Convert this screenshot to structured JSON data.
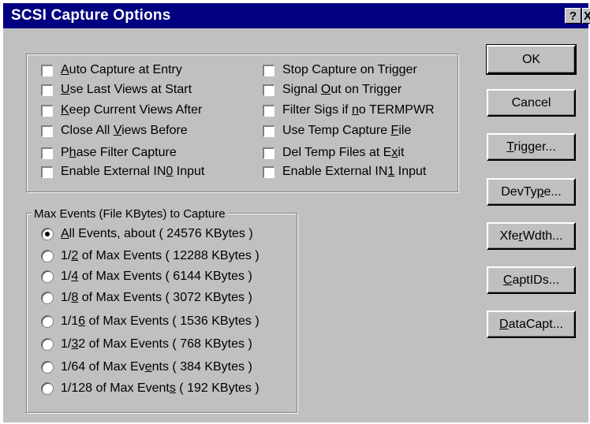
{
  "window": {
    "title": "SCSI Capture Options",
    "help_label": "?",
    "close_label": "X"
  },
  "options": {
    "left": [
      {
        "pre": "",
        "key": "A",
        "post": "uto Capture at Entry"
      },
      {
        "pre": "",
        "key": "U",
        "post": "se Last Views at Start"
      },
      {
        "pre": "",
        "key": "K",
        "post": "eep Current Views After"
      },
      {
        "pre": "Close All ",
        "key": "V",
        "post": "iews Before"
      },
      {
        "pre": "P",
        "key": "h",
        "post": "ase Filter Capture"
      },
      {
        "pre": "Enable External IN",
        "key": "0",
        "post": " Input"
      }
    ],
    "right": [
      {
        "pre": "Stop Capture on Trigger",
        "key": "",
        "post": ""
      },
      {
        "pre": "Signal ",
        "key": "O",
        "post": "ut on Trigger"
      },
      {
        "pre": "Filter Sigs if ",
        "key": "n",
        "post": "o TERMPWR"
      },
      {
        "pre": "Use Temp Capture ",
        "key": "F",
        "post": "ile"
      },
      {
        "pre": "Del Temp Files at E",
        "key": "x",
        "post": "it"
      },
      {
        "pre": "Enable External IN",
        "key": "1",
        "post": " Input"
      }
    ]
  },
  "max_events": {
    "legend": "Max Events (File KBytes) to Capture",
    "selected_index": 0,
    "options": [
      {
        "pre": "",
        "key": "A",
        "post": "ll Events, about ( 24576 KBytes )"
      },
      {
        "pre": "1/",
        "key": "2",
        "post": " of Max Events ( 12288 KBytes )"
      },
      {
        "pre": "1/",
        "key": "4",
        "post": " of Max Events ( 6144 KBytes )"
      },
      {
        "pre": "1/",
        "key": "8",
        "post": " of Max Events ( 3072 KBytes )"
      },
      {
        "pre": "1/1",
        "key": "6",
        "post": " of Max Events ( 1536 KBytes )"
      },
      {
        "pre": "1/",
        "key": "3",
        "post": "2 of Max Events ( 768 KBytes )"
      },
      {
        "pre": "1/64 of Max Ev",
        "key": "e",
        "post": "nts ( 384 KBytes )"
      },
      {
        "pre": "1/128 of Max Event",
        "key": "s",
        "post": " ( 192 KBytes )"
      }
    ]
  },
  "buttons": [
    {
      "pre": "OK",
      "key": "",
      "post": ""
    },
    {
      "pre": "Cancel",
      "key": "",
      "post": ""
    },
    {
      "pre": "",
      "key": "T",
      "post": "rigger..."
    },
    {
      "pre": "DevTy",
      "key": "p",
      "post": "e..."
    },
    {
      "pre": "Xfe",
      "key": "r",
      "post": "Wdth..."
    },
    {
      "pre": "",
      "key": "C",
      "post": "aptIDs..."
    },
    {
      "pre": "",
      "key": "D",
      "post": "ataCapt..."
    }
  ]
}
